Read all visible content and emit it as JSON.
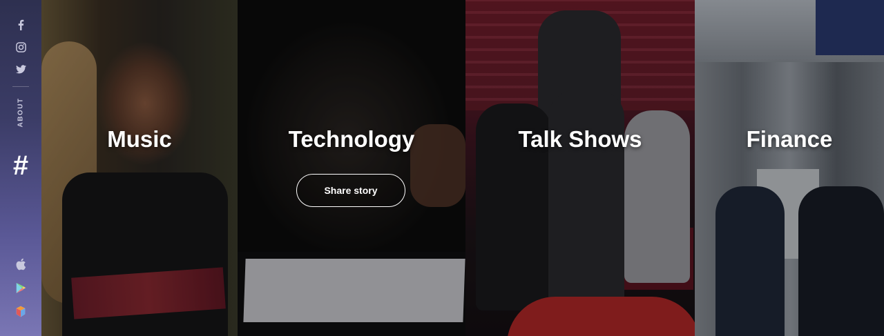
{
  "sidebar": {
    "social": [
      {
        "icon": "facebook-icon",
        "glyph": "f"
      },
      {
        "icon": "instagram-icon"
      },
      {
        "icon": "twitter-icon"
      }
    ],
    "about_label": "ABOUT",
    "logo_glyph": "#",
    "apps": [
      {
        "icon": "apple-icon"
      },
      {
        "icon": "google-play-icon"
      },
      {
        "icon": "amazon-appstore-icon"
      }
    ]
  },
  "panels": [
    {
      "title": "Music"
    },
    {
      "title": "Technology",
      "button_label": "Share story"
    },
    {
      "title": "Talk Shows"
    },
    {
      "title": "Finance"
    }
  ],
  "colors": {
    "sidebar_top": "#2e3050",
    "sidebar_bottom": "#7a76b4",
    "text": "#ffffff"
  }
}
